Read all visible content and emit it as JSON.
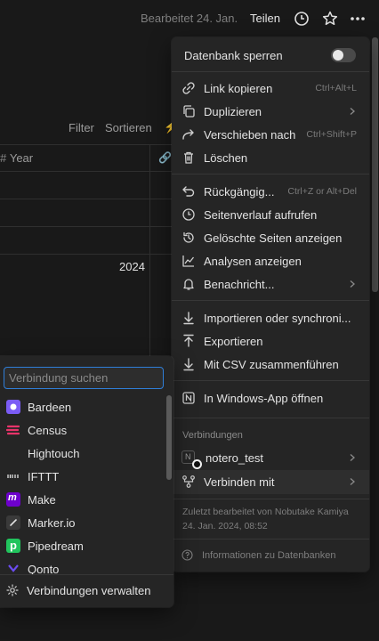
{
  "topbar": {
    "edited": "Bearbeitet 24. Jan.",
    "share": "Teilen"
  },
  "background": {
    "filter": "Filter",
    "sort": "Sortieren",
    "year_header": "Year",
    "year_value": "2024"
  },
  "menu": {
    "lock_label": "Datenbank sperren",
    "lock_on": false,
    "items": [
      {
        "label": "Link kopieren",
        "shortcut": "Ctrl+Alt+L",
        "icon": "link-icon"
      },
      {
        "label": "Duplizieren",
        "shortcut": "",
        "icon": "duplicate-icon",
        "chevron": true
      },
      {
        "label": "Verschieben nach",
        "shortcut": "Ctrl+Shift+P",
        "icon": "move-icon"
      },
      {
        "label": "Löschen",
        "shortcut": "",
        "icon": "trash-icon"
      },
      {
        "label": "Rückgängig...",
        "shortcut": "Ctrl+Z or Alt+Del",
        "icon": "undo-icon"
      },
      {
        "label": "Seitenverlauf aufrufen",
        "shortcut": "",
        "icon": "clock-icon"
      },
      {
        "label": "Gelöschte Seiten anzeigen",
        "shortcut": "",
        "icon": "restore-icon"
      },
      {
        "label": "Analysen anzeigen",
        "shortcut": "",
        "icon": "chart-icon"
      },
      {
        "label": "Benachricht...",
        "shortcut": "",
        "icon": "bell-icon",
        "chevron": true
      },
      {
        "label": "Importieren oder synchroni...",
        "shortcut": "",
        "icon": "import-icon"
      },
      {
        "label": "Exportieren",
        "shortcut": "",
        "icon": "export-icon"
      },
      {
        "label": "Mit CSV zusammenführen",
        "shortcut": "",
        "icon": "csv-merge-icon"
      },
      {
        "label": "In Windows-App öffnen",
        "shortcut": "",
        "icon": "notion-app-icon"
      }
    ],
    "connections_heading": "Verbindungen",
    "connection_item": "notero_test",
    "connect_with": "Verbinden mit",
    "last_edited_line1": "Zuletzt bearbeitet von Nobutake Kamiya",
    "last_edited_line2": "24. Jan. 2024, 08:52",
    "db_info": "Informationen zu Datenbanken"
  },
  "connections": {
    "search_placeholder": "Verbindung suchen",
    "items": [
      {
        "label": "Bardeen",
        "color": "#7b5cf5"
      },
      {
        "label": "Census",
        "color": "#e8346a"
      },
      {
        "label": "Hightouch",
        "color": "#252525"
      },
      {
        "label": "IFTTT",
        "color": "#252525"
      },
      {
        "label": "Make",
        "color": "#6d00cc"
      },
      {
        "label": "Marker.io",
        "color": "#3a3a3a"
      },
      {
        "label": "Pipedream",
        "color": "#21c45d"
      },
      {
        "label": "Qonto",
        "color": "#6b4cf0"
      }
    ],
    "manage": "Verbindungen verwalten"
  }
}
